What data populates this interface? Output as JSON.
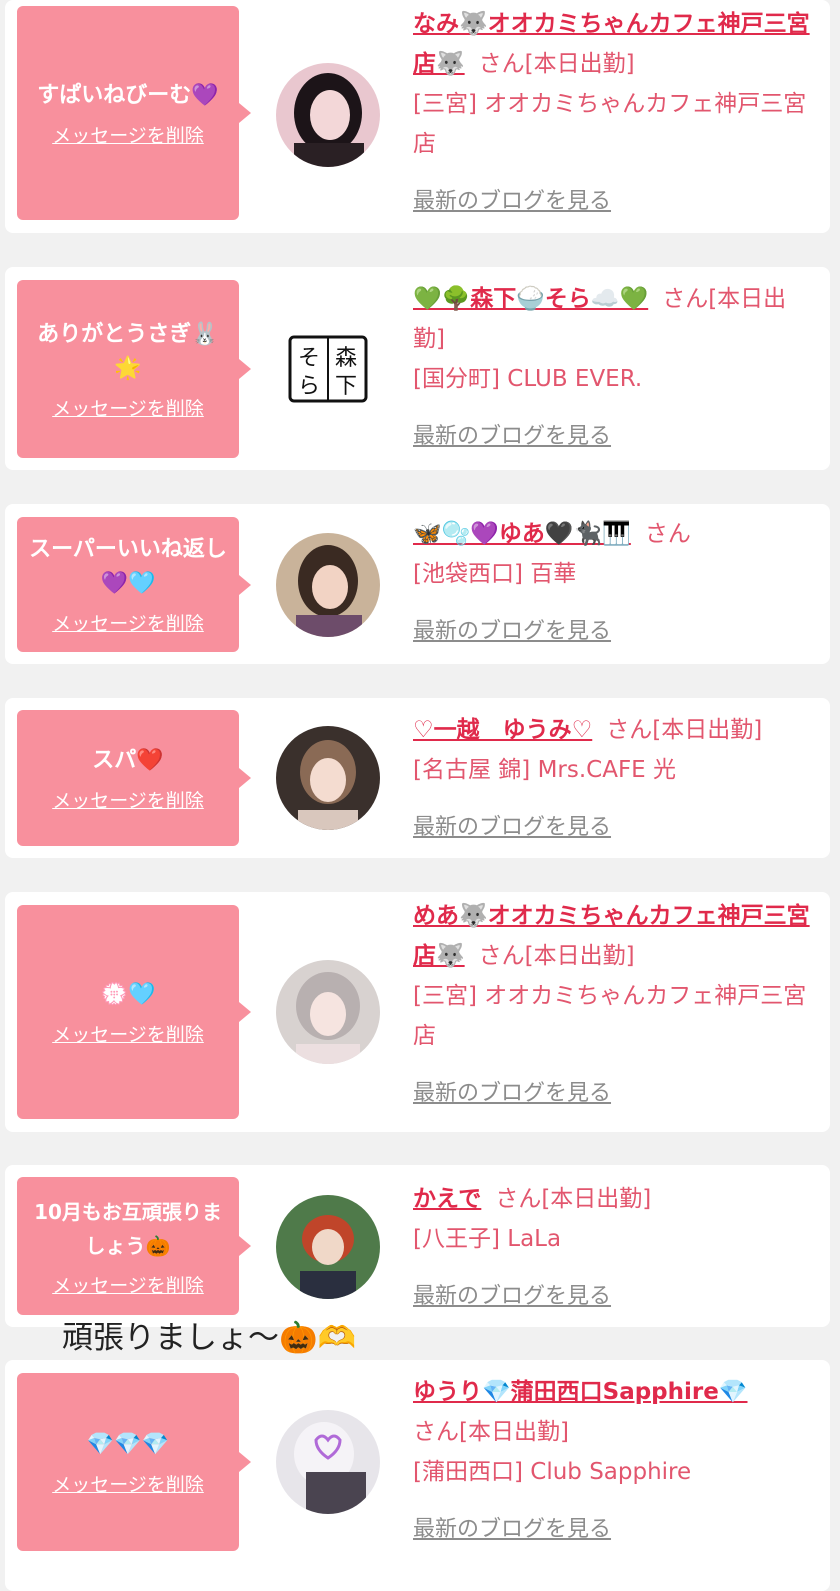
{
  "delete_label": "メッセージを削除",
  "blog_label": "最新のブログを見る",
  "overlay_caption": "頑張りましょ〜🎃🫶",
  "cards": [
    {
      "message": "すぱいねびーむ💜",
      "name": "なみ🐺オオカミちゃんカフェ神戸三宮店🐺",
      "suffix": "さん[本日出勤]",
      "shop": "[三宮] オオカミちゃんカフェ神戸三宮店",
      "avatar_icon": "woman-portrait-icon"
    },
    {
      "message": "ありがとうさぎ🐰🌟",
      "name": "💚🌳森下🍚そら☁️💚",
      "suffix": "さん[本日出勤]",
      "shop": "[国分町] CLUB EVER.",
      "avatar_icon": "logo-morishita-sora-icon",
      "avatar_logo_text": "森下そら"
    },
    {
      "message": "スーパーいいね返し💜🩵",
      "name": "🦋🫧💜ゆあ🖤🐈‍⬛🎹",
      "suffix": "さん",
      "shop": "[池袋西口] 百華",
      "avatar_icon": "woman-portrait-icon"
    },
    {
      "message": "スパ❤️",
      "name": "♡一越　ゆうみ♡",
      "suffix": "さん[本日出勤]",
      "shop": "[名古屋 錦] Mrs.CAFE 光",
      "avatar_icon": "woman-portrait-icon"
    },
    {
      "message": "💮🩵",
      "name": "めあ🐺オオカミちゃんカフェ神戸三宮店🐺",
      "suffix": "さん[本日出勤]",
      "shop": "[三宮] オオカミちゃんカフェ神戸三宮店",
      "avatar_icon": "woman-portrait-icon"
    },
    {
      "message": "10月もお互頑張りましょう🎃",
      "name": "かえで",
      "suffix": "さん[本日出勤]",
      "shop": "[八王子] LaLa",
      "avatar_icon": "costume-portrait-icon"
    },
    {
      "message": "💎💎💎",
      "name": "ゆうり💎蒲田西口Sapphire💎",
      "suffix": "さん[本日出勤]",
      "shop": "[蒲田西口] Club Sapphire",
      "avatar_icon": "woman-portrait-icon"
    }
  ],
  "colors": {
    "bubble": "#f8909d",
    "name": "#e02a4b",
    "text": "#e2566e",
    "blog": "#8c8c8c",
    "background": "#f1f1f1"
  }
}
